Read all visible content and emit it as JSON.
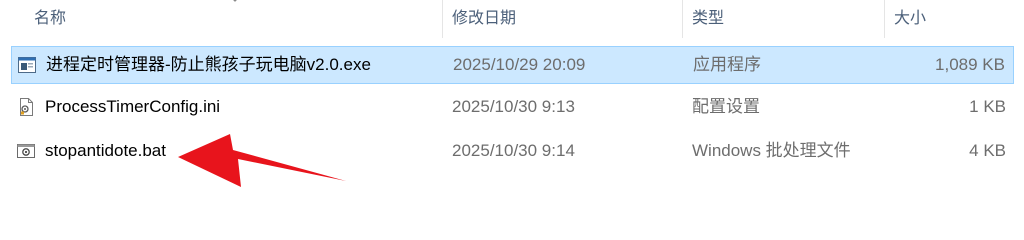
{
  "columns": {
    "name": "名称",
    "date_modified": "修改日期",
    "type": "类型",
    "size": "大小"
  },
  "files": [
    {
      "name": "进程定时管理器-防止熊孩子玩电脑v2.0.exe",
      "date_modified": "2025/10/29 20:09",
      "type": "应用程序",
      "size": "1,089 KB",
      "icon": "exe-icon",
      "selected": true
    },
    {
      "name": "ProcessTimerConfig.ini",
      "date_modified": "2025/10/30 9:13",
      "type": "配置设置",
      "size": "1 KB",
      "icon": "ini-icon",
      "selected": false
    },
    {
      "name": "stopantidote.bat",
      "date_modified": "2025/10/30 9:14",
      "type": "Windows 批处理文件",
      "size": "4 KB",
      "icon": "bat-icon",
      "selected": false
    }
  ],
  "colors": {
    "selection_bg": "#cce8ff",
    "selection_border": "#99d1ff",
    "annotation_arrow": "#e8141c"
  }
}
